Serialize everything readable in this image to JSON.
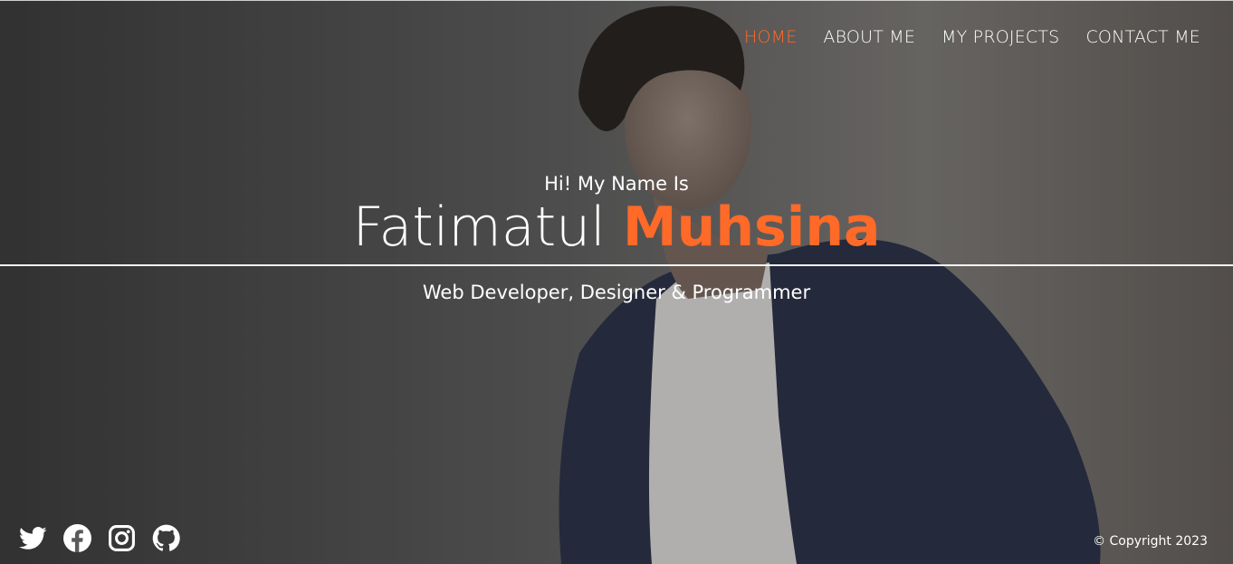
{
  "nav": {
    "items": [
      {
        "label": "HOME",
        "active": true
      },
      {
        "label": "ABOUT ME",
        "active": false
      },
      {
        "label": "MY PROJECTS",
        "active": false
      },
      {
        "label": "CONTACT ME",
        "active": false
      }
    ]
  },
  "hero": {
    "greeting": "Hi! My Name Is",
    "first_name": "Fatimatul",
    "last_name": "Muhsina",
    "role": "Web Developer, Designer & Programmer"
  },
  "social": {
    "icons": [
      "twitter-icon",
      "facebook-icon",
      "instagram-icon",
      "github-icon"
    ]
  },
  "footer": {
    "copyright": "© Copyright 2023"
  },
  "colors": {
    "accent": "#ff6a28",
    "text": "#ffffff"
  }
}
